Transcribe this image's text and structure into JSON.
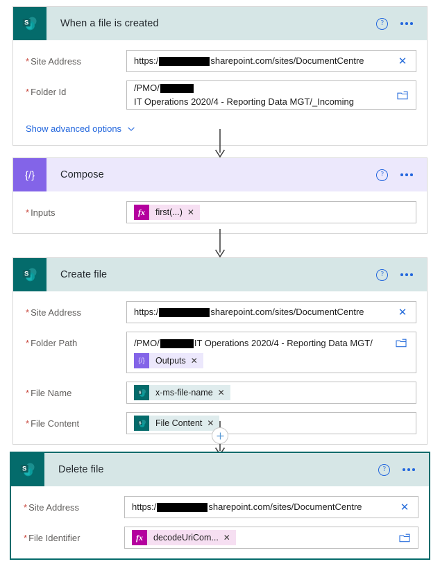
{
  "flow": {
    "steps": [
      {
        "id": "when-a-file-is-created",
        "title": "When a file is created",
        "connector": "sharepoint",
        "help_label": "?",
        "more_label": "•••",
        "advanced_link": "Show advanced options",
        "fields": [
          {
            "label": "Site Address",
            "required_marker": "*",
            "value_prefix": "https:/",
            "value_suffix": "sharepoint.com/sites/DocumentCentre",
            "redacted": true,
            "trailing_icon": "clear-x-icon",
            "trailing_glyph": "✕"
          },
          {
            "label": "Folder Id",
            "required_marker": "*",
            "value_prefix": "/PMO/",
            "value_suffix": "IT Operations 2020/4 - Reporting Data MGT/_Incoming",
            "redacted": true,
            "trailing_icon": "folder-picker-icon"
          }
        ]
      },
      {
        "id": "compose",
        "title": "Compose",
        "connector": "compose",
        "help_label": "?",
        "more_label": "•••",
        "fields": [
          {
            "label": "Inputs",
            "required_marker": "*",
            "token": {
              "kind": "expression",
              "icon": "fx-icon",
              "icon_label": "fx",
              "text": "first(...)",
              "remove_label": "✕"
            }
          }
        ]
      },
      {
        "id": "create-file",
        "title": "Create file",
        "connector": "sharepoint",
        "help_label": "?",
        "more_label": "•••",
        "fields": [
          {
            "label": "Site Address",
            "required_marker": "*",
            "value_prefix": "https:/",
            "value_suffix": "sharepoint.com/sites/DocumentCentre",
            "redacted": true,
            "trailing_icon": "clear-x-icon",
            "trailing_glyph": "✕"
          },
          {
            "label": "Folder Path",
            "required_marker": "*",
            "value_prefix": "/PMO/",
            "value_suffix": "IT Operations 2020/4 - Reporting Data MGT/",
            "redacted": true,
            "trailing_icon": "folder-picker-icon",
            "token": {
              "kind": "compose-output",
              "icon": "compose-icon",
              "icon_label": "{/}",
              "text": "Outputs",
              "remove_label": "✕"
            }
          },
          {
            "label": "File Name",
            "required_marker": "*",
            "token": {
              "kind": "sharepoint-output",
              "icon": "sharepoint-icon",
              "text": "x-ms-file-name",
              "remove_label": "✕"
            }
          },
          {
            "label": "File Content",
            "required_marker": "*",
            "token": {
              "kind": "sharepoint-output",
              "icon": "sharepoint-icon",
              "text": "File Content",
              "remove_label": "✕"
            }
          }
        ]
      },
      {
        "id": "delete-file",
        "title": "Delete file",
        "connector": "sharepoint",
        "selected": true,
        "help_label": "?",
        "more_label": "•••",
        "fields": [
          {
            "label": "Site Address",
            "required_marker": "*",
            "value_prefix": "https:/",
            "value_suffix": "sharepoint.com/sites/DocumentCentre",
            "redacted": true,
            "trailing_icon": "clear-x-icon",
            "trailing_glyph": "✕"
          },
          {
            "label": "File Identifier",
            "required_marker": "*",
            "trailing_icon": "folder-picker-icon",
            "token": {
              "kind": "expression",
              "icon": "fx-icon",
              "icon_label": "fx",
              "text": "decodeUriCom...",
              "remove_label": "✕"
            }
          }
        ]
      }
    ],
    "insert_step_button": {
      "name": "add-step-button",
      "glyph": "+"
    },
    "colors": {
      "sharepoint_teal": "#046b6b",
      "sharepoint_header": "#d6e6e6",
      "compose_purple": "#8364e8",
      "compose_header": "#ece8fc",
      "expression_magenta": "#b4009e",
      "link_blue": "#2266dd",
      "required_red": "#c94a40",
      "selected_border": "#056b6b"
    }
  }
}
